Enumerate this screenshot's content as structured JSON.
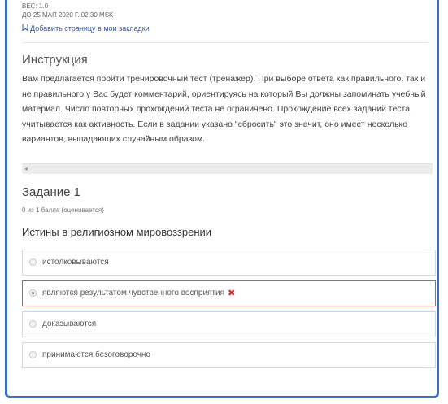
{
  "header": {
    "weight": "ВЕС: 1.0",
    "deadline": "ДО 25 МАЯ 2020 Г. 02:30 MSK",
    "bookmark_link": "Добавить страницу в мои закладки"
  },
  "instruction": {
    "title": "Инструкция",
    "text": "Вам предлагается пройти тренировочный тест (тренажер). При выборе ответа как правильного, так и не правильного у Вас будет комментарий, ориентируясь на который Вы должны запоминать учебный материал. Число повторных прохождений теста не ограничено. Прохождение всех заданий теста учитывается как активность. Если в задании указано \"сбросить\" это значит, оно имеет несколько вариантов, выпадающих случайным образом."
  },
  "task": {
    "title": "Задание 1",
    "score": "0 из 1 балла (оценивается)",
    "question": "Истины в религиозном мировоззрении",
    "options": [
      {
        "label": "истолковываются",
        "selected": false,
        "result": ""
      },
      {
        "label": "являются результатом чувственного восприятия",
        "selected": true,
        "result": "incorrect"
      },
      {
        "label": "доказываются",
        "selected": false,
        "result": ""
      },
      {
        "label": "принимаются безоговорочно",
        "selected": false,
        "result": ""
      }
    ]
  },
  "colors": {
    "frame_border": "#3a6fc4",
    "link": "#2a5db0",
    "incorrect": "#d9252a"
  },
  "icons": {
    "bookmark": "bookmark-icon",
    "incorrect": "cross-icon",
    "scroll_left": "scroll-left-arrow-icon"
  }
}
